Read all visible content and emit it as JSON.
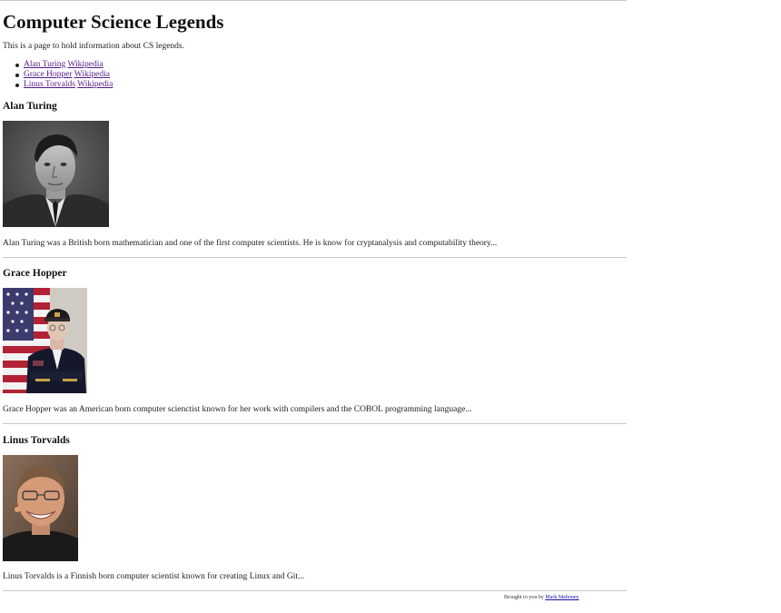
{
  "page": {
    "title": "Computer Science Legends",
    "intro": "This is a page to hold information about CS legends."
  },
  "nav": [
    {
      "name_link": "Alan Turing",
      "wiki_link": "Wikipedia"
    },
    {
      "name_link": "Grace Hopper",
      "wiki_link": "Wikipedia"
    },
    {
      "name_link": "Linus Torvalds",
      "wiki_link": "Wikipedia"
    }
  ],
  "legends": [
    {
      "heading": "Alan Turing",
      "bio": "Alan Turing was a British born mathematician and one of the first computer scientists. He is know for cryptanalysis and computability theory..."
    },
    {
      "heading": "Grace Hopper",
      "bio": "Grace Hopper was an American born computer scienctist known for her work with compilers and the COBOL programming language..."
    },
    {
      "heading": "Linus Torvalds",
      "bio": "Linus Torvalds is a Finnish born computer scientist known for creating Linux and Git..."
    }
  ],
  "footer": {
    "prefix": "Brought to you by",
    "author_link": "Mark Mahoney"
  }
}
